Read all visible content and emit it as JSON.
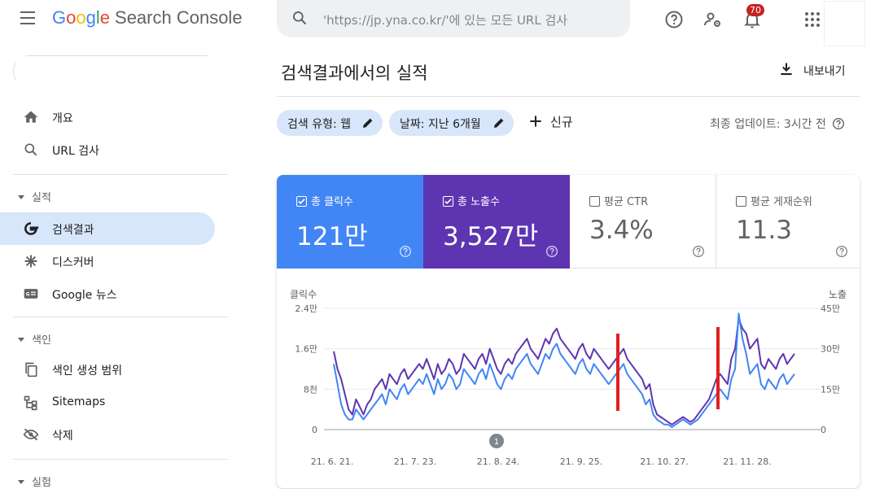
{
  "header": {
    "logo": {
      "g1": "G",
      "g2": "o",
      "g3": "o",
      "g4": "g",
      "g5": "l",
      "g6": "e",
      "product": "Search Console"
    },
    "search_placeholder": "'https://jp.yna.co.kr/'에 있는 모든 URL 검사",
    "notifications_count": "70"
  },
  "sidebar": {
    "items": [
      {
        "label": "개요",
        "icon": "home-icon"
      },
      {
        "label": "URL 검사",
        "icon": "search-icon"
      },
      {
        "label": "검색결과",
        "icon": "google-g-icon",
        "active": true
      },
      {
        "label": "디스커버",
        "icon": "asterisk-icon"
      },
      {
        "label": "Google 뉴스",
        "icon": "google-news-icon"
      },
      {
        "label": "색인 생성 범위",
        "icon": "copy-icon"
      },
      {
        "label": "Sitemaps",
        "icon": "sitemap-icon"
      },
      {
        "label": "삭제",
        "icon": "eye-off-icon"
      }
    ],
    "sections": {
      "performance": "실적",
      "index": "색인",
      "experience": "실험"
    }
  },
  "main": {
    "title": "검색결과에서의 실적",
    "export_label": "내보내기",
    "filters": [
      {
        "label": "검색 유형: 웹"
      },
      {
        "label": "날짜: 지난 6개월"
      }
    ],
    "new_label": "신규",
    "last_update": "최종 업데이트: 3시간 전"
  },
  "metrics": [
    {
      "name": "총 클릭수",
      "value": "121만",
      "checked": true,
      "color": "#4285f4"
    },
    {
      "name": "총 노출수",
      "value": "3,527만",
      "checked": true,
      "color": "#5e35b1"
    },
    {
      "name": "평균 CTR",
      "value": "3.4%",
      "checked": false
    },
    {
      "name": "평균 게재순위",
      "value": "11.3",
      "checked": false
    }
  ],
  "chart_data": {
    "type": "line",
    "left_axis_label": "클릭수",
    "right_axis_label": "노출",
    "left_ticks": [
      "0",
      "8천",
      "1.6만",
      "2.4만"
    ],
    "right_ticks": [
      "0",
      "15만",
      "30만",
      "45만"
    ],
    "left_max": 24000,
    "right_max": 450000,
    "x_labels": [
      "21. 6. 21.",
      "21. 7. 23.",
      "21. 8. 24.",
      "21. 9. 25.",
      "21. 10. 27.",
      "21. 11. 28."
    ],
    "annotation": "1",
    "series": [
      {
        "color": "#5e35b1",
        "values": [
          15.5,
          12,
          10,
          7,
          4,
          3,
          6,
          4.5,
          3,
          5,
          6,
          8,
          9,
          10,
          8,
          11,
          10,
          9,
          11,
          12,
          10,
          11,
          12,
          13,
          12,
          14,
          12,
          10,
          13,
          11,
          12,
          14,
          13,
          11,
          12,
          15,
          14,
          13,
          12,
          14,
          15,
          13,
          16,
          14,
          12,
          11,
          13,
          14,
          13,
          15,
          16,
          17,
          18,
          16,
          15,
          14,
          16,
          18,
          17,
          19,
          20,
          18,
          17,
          16,
          15,
          14,
          16,
          17,
          15,
          14,
          16,
          15,
          14,
          13,
          12,
          13,
          14,
          15,
          16,
          14,
          13,
          12,
          11,
          10,
          8,
          9,
          5,
          3,
          2.5,
          2,
          1.5,
          1,
          1.5,
          2,
          2.5,
          2,
          1.5,
          2,
          3,
          4,
          5,
          6,
          8,
          10,
          11,
          10,
          9,
          14,
          16,
          22,
          20,
          19,
          16,
          17,
          18,
          13,
          12,
          14,
          13,
          12,
          14,
          15,
          13,
          14,
          15
        ]
      },
      {
        "color": "#4285f4",
        "values": [
          13,
          9,
          5,
          3,
          2,
          2,
          4,
          3,
          2,
          3,
          4,
          5,
          6,
          7,
          5,
          8,
          7,
          6,
          8,
          9,
          7,
          8,
          9,
          10,
          9,
          11,
          9,
          7,
          10,
          8,
          9,
          11,
          10,
          8,
          9,
          12,
          11,
          10,
          9,
          11,
          12,
          10,
          13,
          11,
          9,
          8,
          10,
          11,
          10,
          12,
          13,
          14,
          15,
          13,
          12,
          11,
          13,
          15,
          14,
          16,
          17,
          15,
          14,
          13,
          12,
          11,
          13,
          14,
          12,
          11,
          13,
          12,
          11,
          10,
          9,
          10,
          11,
          12,
          13,
          11,
          10,
          9,
          8,
          7,
          5,
          6,
          3,
          2,
          1.5,
          1,
          1,
          0.5,
          1,
          1.5,
          2,
          1.5,
          1,
          1.5,
          2,
          3,
          4,
          5,
          6,
          7,
          8,
          7,
          6,
          10,
          12,
          23,
          18,
          15,
          11,
          12,
          13,
          9,
          8,
          10,
          9,
          8,
          10,
          11,
          9,
          10,
          11
        ]
      }
    ]
  }
}
